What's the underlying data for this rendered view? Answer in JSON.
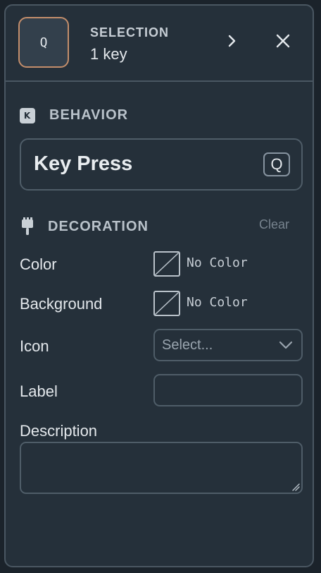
{
  "header": {
    "key_label": "Q",
    "title": "SELECTION",
    "subtitle": "1 key",
    "next_icon": "chevron-right-icon",
    "close_icon": "close-icon"
  },
  "behavior": {
    "icon_letter": "K",
    "title": "BEHAVIOR",
    "value": "Key Press",
    "key": "Q"
  },
  "decoration": {
    "icon": "paintbrush-icon",
    "title": "DECORATION",
    "clear_label": "Clear",
    "color": {
      "label": "Color",
      "value": "No Color"
    },
    "background": {
      "label": "Background",
      "value": "No Color"
    },
    "icon_field": {
      "label": "Icon",
      "placeholder": "Select..."
    },
    "label_field": {
      "label": "Label",
      "value": ""
    },
    "description_field": {
      "label": "Description",
      "value": ""
    }
  },
  "colors": {
    "panel_bg": "#25303a",
    "border": "#4a5762",
    "accent_key_border": "#c48e6b"
  }
}
